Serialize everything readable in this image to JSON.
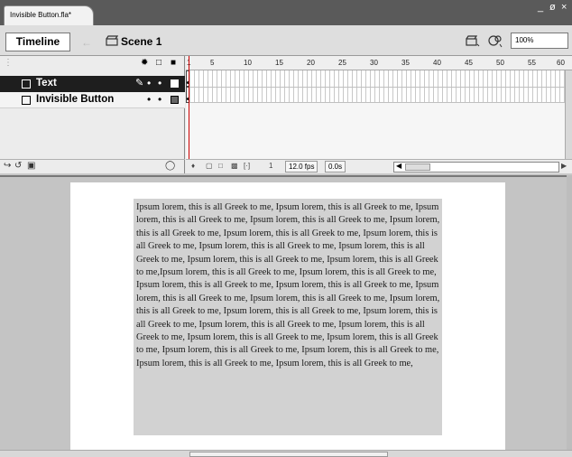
{
  "document": {
    "tab_title": "Invisible Button.fla*",
    "window_controls": [
      "_",
      "ø",
      "×"
    ]
  },
  "editbar": {
    "timeline_label": "Timeline",
    "scene_label": "Scene 1",
    "zoom_value": "100%"
  },
  "timeline": {
    "layers": [
      {
        "name": "Text",
        "selected": true
      },
      {
        "name": "Invisible Button",
        "selected": false
      }
    ],
    "ruler_ticks": [
      "1",
      "5",
      "10",
      "15",
      "20",
      "25",
      "30",
      "35",
      "40",
      "45",
      "50",
      "55",
      "60"
    ],
    "footer": {
      "current_frame": "1",
      "frame_rate": "12.0 fps",
      "elapsed_time": "0.0s"
    }
  },
  "stage": {
    "text_content": "Ipsum lorem, this is all Greek to me, Ipsum lorem, this is all Greek to me, Ipsum lorem, this is all Greek to me, Ipsum lorem, this is all Greek to me, Ipsum lorem, this is all Greek to me, Ipsum lorem, this is all Greek to me, Ipsum lorem, this is all Greek to me, Ipsum lorem, this is all Greek to me, Ipsum lorem, this is all Greek to me, Ipsum lorem, this is all Greek to me, Ipsum lorem, this is all Greek to me,Ipsum lorem, this is all Greek to me, Ipsum lorem, this is all Greek to me, Ipsum lorem, this is all Greek to me, Ipsum lorem, this is all Greek to me, Ipsum lorem, this is all Greek to me, Ipsum lorem, this is all Greek to me, Ipsum lorem, this is all Greek to me, Ipsum lorem, this is all Greek to me, Ipsum lorem, this is all Greek to me, Ipsum lorem, this is all Greek to me, Ipsum lorem, this is all Greek to me, Ipsum lorem, this is all Greek to me, Ipsum lorem, this is all Greek to me, Ipsum lorem, this is all Greek to me, Ipsum lorem, this is all Greek to me, Ipsum lorem, this is all Greek to me, Ipsum lorem, this is all Greek to me,"
  }
}
